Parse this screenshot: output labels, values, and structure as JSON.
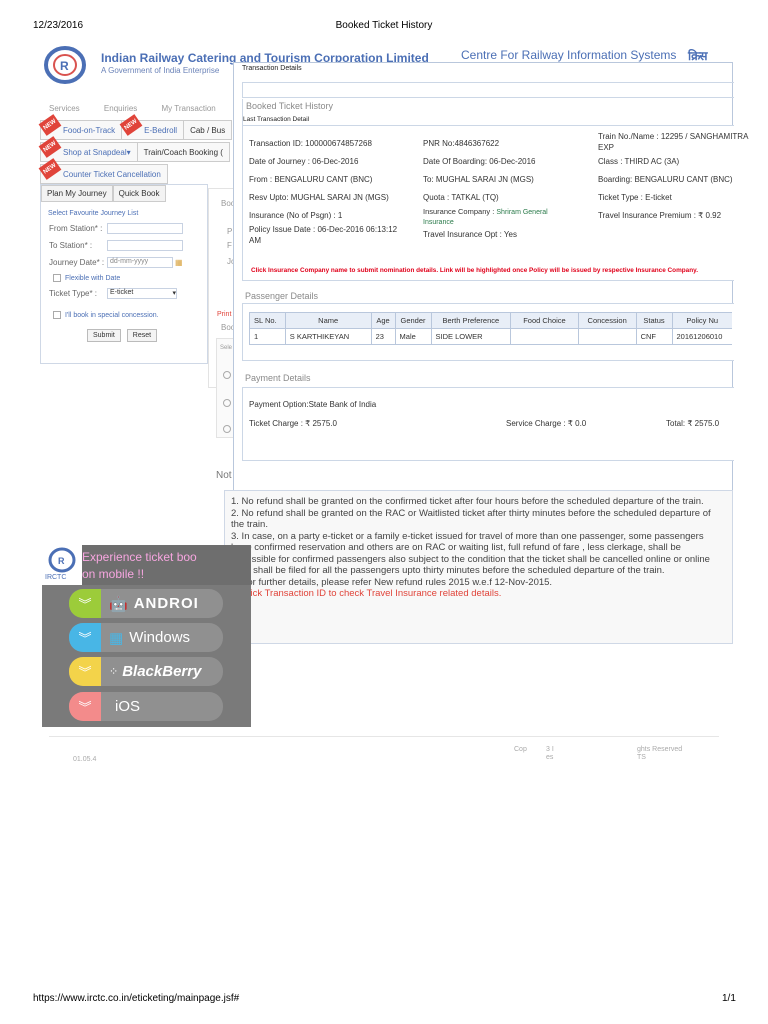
{
  "print": {
    "date": "12/23/2016",
    "title": "Booked Ticket History",
    "url": "https://www.irctc.co.in/eticketing/mainpage.jsf#",
    "page": "1/1"
  },
  "header": {
    "org_name": "Indian Railway Catering and Tourism Corporation Limited",
    "org_sub": "A Government of India Enterprise",
    "cris": "Centre For Railway Information Systems",
    "cris_logo": "क्रिस"
  },
  "nav": [
    "Services",
    "Enquiries",
    "My Transaction",
    "My"
  ],
  "tabs_row1": [
    {
      "label": "Food-on-Track",
      "new": true
    },
    {
      "label": "E-Bedroll",
      "new": true
    },
    {
      "label": "Cab / Bus",
      "new": false
    }
  ],
  "tabs_row2": [
    {
      "label": "Shop at Snapdeal▾",
      "new": true
    },
    {
      "label": "Train/Coach Booking (",
      "new": false
    }
  ],
  "tabs_row3": [
    {
      "label": "Counter Ticket Cancellation",
      "new": true
    }
  ],
  "left_panel": {
    "tab1": "Plan My Journey",
    "tab2": "Quick Book",
    "title": "Select Favourite Journey List",
    "from_label": "From Station* :",
    "to_label": "To Station* :",
    "date_label": "Journey Date* :",
    "date_placeholder": "dd-mm-yyyy",
    "flexible": "Flexible with Date",
    "ticket_type_label": "Ticket Type* :",
    "ticket_type_value": "E-ticket",
    "concession": "I'll book in special concession.",
    "submit": "Submit",
    "reset": "Reset"
  },
  "behind": {
    "book": "Book",
    "p": "P",
    "fr": "F",
    "jo": "Jo",
    "print": "Print",
    "book2": "Boo",
    "sel": "Sele",
    "notes": "Not"
  },
  "modal": {
    "title": "Transaction Details",
    "bth": "Booked Ticket History",
    "last_txn": "Last Transaction Detail",
    "transaction_id": "Transaction ID: 100000674857268",
    "pnr": "PNR No:4846367622",
    "train": "Train No./Name : 12295 / SANGHAMITRA",
    "train2": "EXP",
    "doj": "Date of Journey : 06-Dec-2016",
    "dob": "Date Of Boarding: 06-Dec-2016",
    "class": "Class : THIRD AC (3A)",
    "from": "From : BENGALURU CANT (BNC)",
    "to": "To: MUGHAL SARAI JN (MGS)",
    "boarding": "Boarding: BENGALURU CANT (BNC)",
    "resv": "Resv Upto: MUGHAL SARAI JN (MGS)",
    "quota": "Quota : TATKAL (TQ)",
    "ticket_type": "Ticket Type : E-ticket",
    "insurance": "Insurance (No of Psgn) : 1",
    "ins_company_label": "Insurance Company :",
    "ins_company": "Shriram General Insurance",
    "travel_premium": "Travel Insurance Premium : ₹ 0.92",
    "policy_date": "Policy Issue Date : 06-Dec-2016 06:13:12",
    "policy_date2": "AM",
    "travel_opt": "Travel Insurance Opt : Yes",
    "red_note": "Click Insurance Company name to submit nomination details. Link will be highlighted once Policy will be issued by respective Insurance Company.",
    "passenger_details": "Passenger Details",
    "payment_details": "Payment Details",
    "payment_option": "Payment Option:State Bank of India",
    "ticket_charge": "Ticket Charge : ₹ 2575.0",
    "service_charge": "Service Charge : ₹ 0.0",
    "total": "Total: ₹ 2575.0"
  },
  "passengers": {
    "headers": [
      "SL No.",
      "Name",
      "Age",
      "Gender",
      "Berth Preference",
      "Food Choice",
      "Concession",
      "Status",
      "Policy Nu"
    ],
    "rows": [
      [
        "1",
        "S KARTHIKEYAN",
        "23",
        "Male",
        "SIDE LOWER",
        "",
        "",
        "CNF",
        "20161206010"
      ]
    ]
  },
  "notes": [
    "1. No refund shall be granted on the confirmed ticket after four hours before the scheduled departure of the train.",
    "2. No refund shall be granted on the RAC or Waitlisted ticket after thirty minutes before the scheduled departure of the train.",
    "3. In case, on a party e-ticket or a family e-ticket issued for travel of more than one passenger, some passengers have confirmed reservation and others are on RAC or waiting list, full refund of fare , less clerkage, shall be admissible for confirmed passengers also subject to the condition that the ticket shall be cancelled online or online TDR shall be filed for all the passengers upto thirty minutes before the scheduled departure of the train.",
    "4. For further details, please refer New refund rules 2015 w.e.f 12-Nov-2015."
  ],
  "note5": "5. Click Transaction ID to check Travel Insurance related details.",
  "banner": {
    "brand": "IRCTC",
    "headline1": "Experience ticket boo",
    "headline2": "on mobile !!",
    "android": "ANDROI",
    "windows": "Windows",
    "blackberry": "BlackBerry",
    "ios": "iOS"
  },
  "footer": {
    "copy": "Cop",
    "c2": "3 I",
    "c3": "es",
    "rights": "ghts Reserved",
    "rights2": "TS",
    "ver": "01.05.4"
  },
  "colors": {
    "accent": "#4b6fb5",
    "android": "#9ccc3a",
    "windows": "#48b6e6",
    "blackberry": "#f3d34a",
    "ios": "#f38b8b"
  }
}
